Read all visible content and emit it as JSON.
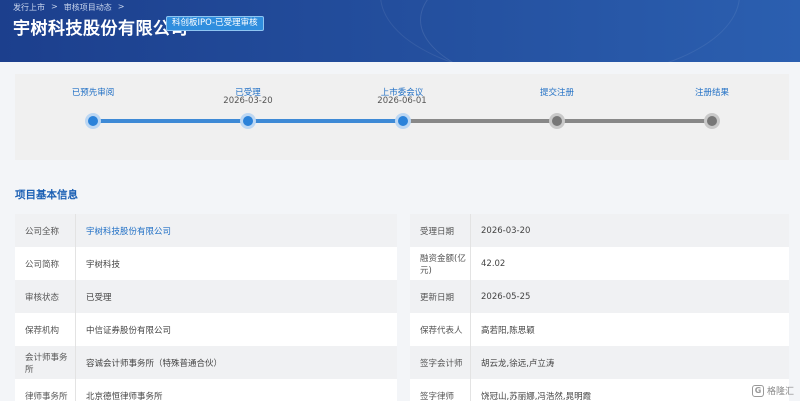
{
  "header": {
    "breadcrumb": [
      "发行上市",
      "审核项目动态"
    ],
    "title": "宇树科技股份有限公司",
    "board": "科创板IPO-已受理审核"
  },
  "steps": [
    {
      "label": "已预先审阅",
      "date": "",
      "status": "done"
    },
    {
      "label": "已受理",
      "date": "2026-03-20",
      "status": "done"
    },
    {
      "label": "上市委会议",
      "date": "2026-06-01",
      "status": "done"
    },
    {
      "label": "提交注册",
      "date": "",
      "status": "todo"
    },
    {
      "label": "注册结果",
      "date": "",
      "status": "todo"
    }
  ],
  "section_title": "项目基本信息",
  "info": {
    "left": [
      {
        "label": "公司全称",
        "value": "宇树科技股份有限公司",
        "link": true
      },
      {
        "label": "公司简称",
        "value": "宇树科技",
        "link": false
      },
      {
        "label": "审核状态",
        "value": "已受理",
        "link": false
      },
      {
        "label": "保荐机构",
        "value": "中信证券股份有限公司",
        "link": false
      },
      {
        "label": "会计师事务所",
        "value": "容诚会计师事务所（特殊普通合伙）",
        "link": false
      },
      {
        "label": "律师事务所",
        "value": "北京德恒律师事务所",
        "link": false
      }
    ],
    "right": [
      {
        "label": "受理日期",
        "value": "2026-03-20"
      },
      {
        "label": "融资金额(亿元)",
        "value": "42.02"
      },
      {
        "label": "更新日期",
        "value": "2026-05-25"
      },
      {
        "label": "保荐代表人",
        "value": "高若阳,陈思颖"
      },
      {
        "label": "签字会计师",
        "value": "胡云龙,徐远,卢立涛"
      },
      {
        "label": "签字律师",
        "value": "饶冠山,苏丽娜,冯浩然,晁明霞"
      }
    ]
  },
  "watermark": "格隆汇",
  "colors": {
    "header": "#24509f",
    "accent": "#2b82d9",
    "pending": "#777777"
  }
}
